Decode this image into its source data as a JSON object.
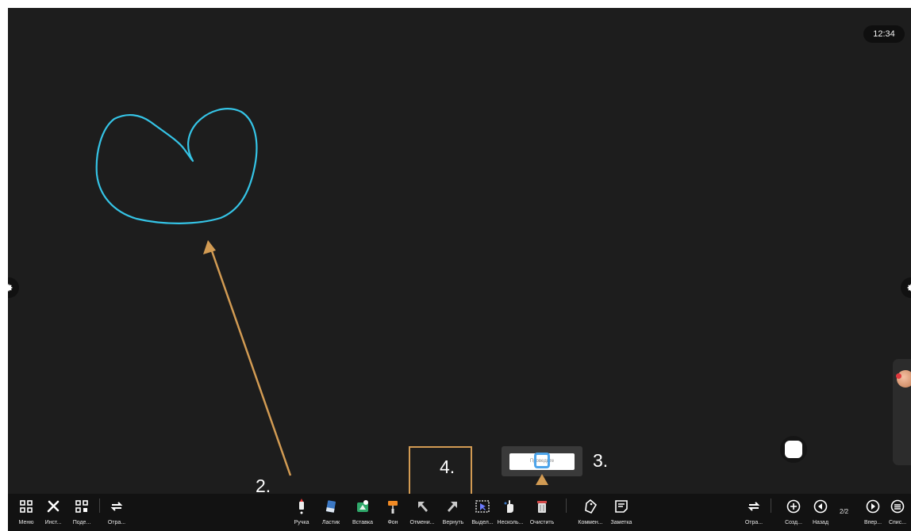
{
  "clock": "12:34",
  "annotations": {
    "step2": "2.",
    "step3": "3.",
    "step4": "4."
  },
  "tooltip": {
    "text": "Проведите"
  },
  "toolbar": {
    "left": [
      {
        "label": "Меню",
        "icon": "grid-icon"
      },
      {
        "label": "Инст...",
        "icon": "tools-icon"
      },
      {
        "label": "Поде...",
        "icon": "qr-icon"
      },
      {
        "label": "Отра...",
        "icon": "swap-icon"
      }
    ],
    "center": [
      {
        "label": "Ручка",
        "icon": "pen-icon"
      },
      {
        "label": "Ластик",
        "icon": "eraser-icon"
      },
      {
        "label": "Вставка",
        "icon": "insert-icon"
      },
      {
        "label": "Фон",
        "icon": "paint-roller-icon"
      },
      {
        "label": "Отмени...",
        "icon": "undo-icon"
      },
      {
        "label": "Вернуть",
        "icon": "redo-icon"
      },
      {
        "label": "Выдел...",
        "icon": "select-icon"
      },
      {
        "label": "Несколь...",
        "icon": "multi-touch-icon"
      },
      {
        "label": "Очистить",
        "icon": "clear-icon"
      },
      {
        "label": "Коммен...",
        "icon": "comment-tag-icon"
      },
      {
        "label": "Заметка",
        "icon": "note-icon"
      }
    ],
    "right": [
      {
        "label": "Отра...",
        "icon": "swap-icon"
      },
      {
        "label": "Созд...",
        "icon": "plus-circle-icon"
      },
      {
        "label": "Назад",
        "icon": "prev-page-icon"
      },
      {
        "label": "Впер...",
        "icon": "next-page-icon"
      },
      {
        "label": "Спис...",
        "icon": "list-icon"
      }
    ],
    "page_indicator": "2/2"
  },
  "colors": {
    "board": "#1d1d1d",
    "toolbar": "#121212",
    "stroke": "#35c4e6",
    "annotation": "#d29b53"
  }
}
